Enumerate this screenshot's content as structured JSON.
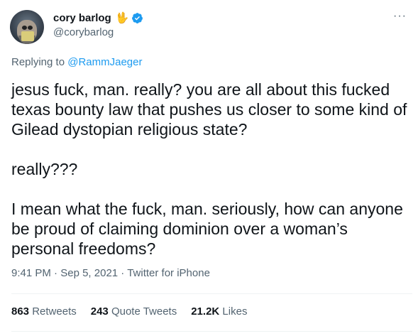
{
  "author": {
    "name": "cory barlog",
    "emoji": "🖖",
    "handle": "@corybarlog"
  },
  "more_label": "···",
  "replying": {
    "prefix": "Replying to ",
    "mention": "@RammJaeger"
  },
  "tweet_text": "jesus fuck, man. really? you are all about this fucked texas bounty law that pushes us closer to some kind of Gilead dystopian religious state?\n\nreally???\n\nI mean what the fuck, man. seriously, how can anyone be proud of claiming dominion over a woman’s personal freedoms?",
  "meta": {
    "time": "9:41 PM",
    "sep1": " · ",
    "date": "Sep 5, 2021",
    "sep2": " · ",
    "source": "Twitter for iPhone"
  },
  "stats": {
    "retweets_count": "863",
    "retweets_label": "Retweets",
    "quotes_count": "243",
    "quotes_label": "Quote Tweets",
    "likes_count": "21.2K",
    "likes_label": "Likes"
  },
  "colors": {
    "accent": "#1d9bf0",
    "secondary_text": "#536471",
    "emoji": "#f0c030"
  }
}
